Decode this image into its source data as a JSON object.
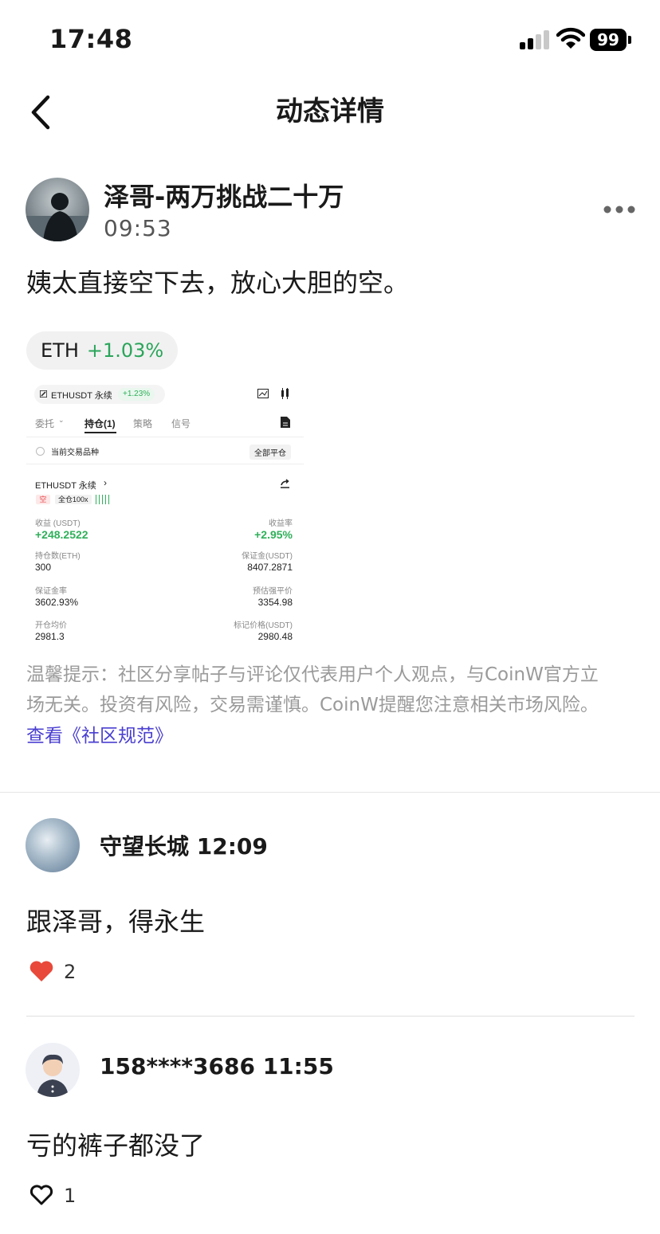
{
  "status_bar": {
    "time": "17:48",
    "battery": "99"
  },
  "header": {
    "title": "动态详情"
  },
  "post": {
    "author": "泽哥-两万挑战二十万",
    "time": "09:53",
    "text": "姨太直接空下去，放心大胆的空。",
    "tag": {
      "symbol": "ETH",
      "change": "+1.03%"
    },
    "screenshot": {
      "pair": "ETHUSDT 永续",
      "pair_change": "+1.23%",
      "tabs": [
        "委托",
        "持仓(1)",
        "策略",
        "信号"
      ],
      "current_only": "当前交易品种",
      "close_all": "全部平仓",
      "position_pair": "ETHUSDT 永续",
      "side": "空",
      "leverage": "全仓100x",
      "pnl_label": "收益 (USDT)",
      "pnl_value": "+248.2522",
      "roe_label": "收益率",
      "roe_value": "+2.95%",
      "size_label": "持仓数(ETH)",
      "size_value": "300",
      "margin_label": "保证金(USDT)",
      "margin_value": "8407.2871",
      "margin_rate_label": "保证金率",
      "margin_rate_value": "3602.93%",
      "liq_label": "预估强平价",
      "liq_value": "3354.98",
      "entry_label": "开仓均价",
      "entry_value": "2981.3",
      "mark_label": "标记价格(USDT)",
      "mark_value": "2980.48"
    },
    "disclaimer_line1": "温馨提示：社区分享帖子与评论仅代表用户个人观点，与CoinW官方立",
    "disclaimer_line2": "场无关。投资有风险，交易需谨慎。CoinW提醒您注意相关市场风险。",
    "rules_link": "查看《社区规范》"
  },
  "comments": [
    {
      "author": "守望长城",
      "time": "12:09",
      "text": "跟泽哥，得永生",
      "likes": "2",
      "liked": true
    },
    {
      "author": "158****3686",
      "time": "11:55",
      "text": "亏的裤子都没了",
      "likes": "1",
      "liked": false
    }
  ],
  "colors": {
    "accent_green": "#2aa55a",
    "link": "#4a3fd0",
    "like_red": "#e8493a"
  }
}
